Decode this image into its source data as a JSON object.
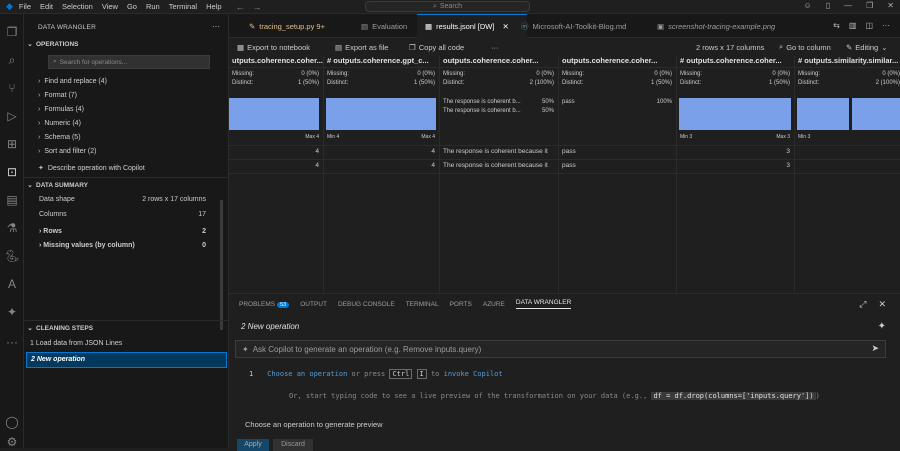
{
  "menu": [
    "File",
    "Edit",
    "Selection",
    "View",
    "Go",
    "Run",
    "Terminal",
    "Help"
  ],
  "search_label": "Search",
  "sidebar": {
    "title": "DATA WRANGLER",
    "operations_title": "OPERATIONS",
    "search_placeholder": "Search for operations...",
    "operations": [
      "Find and replace (4)",
      "Format (7)",
      "Formulas (4)",
      "Numeric (4)",
      "Schema (5)",
      "Sort and filter (2)"
    ],
    "describe_label": "Describe operation with Copilot",
    "summary_title": "DATA SUMMARY",
    "data_shape_label": "Data shape",
    "data_shape_value": "2 rows x 17 columns",
    "columns_label": "Columns",
    "columns_value": "17",
    "rows_label": "Rows",
    "rows_value": "2",
    "missing_label": "Missing values (by column)",
    "missing_value": "0",
    "cleaning_title": "CLEANING STEPS",
    "steps": [
      "1  Load data from JSON Lines",
      "2  New operation"
    ]
  },
  "tabs": [
    {
      "label": "tracing_setup.py 9+",
      "icon": "python-icon"
    },
    {
      "label": "Evaluation",
      "icon": "evaluation-icon"
    },
    {
      "label": "results.jsonl [DW]",
      "icon": "table-icon"
    },
    {
      "label": "Microsoft-AI-Toolkit-Blog.md",
      "icon": "markdown-icon"
    },
    {
      "label": "screenshot-tracing-example.png",
      "icon": "image-icon"
    }
  ],
  "toolbar": {
    "export_notebook": "Export to notebook",
    "export_file": "Export as file",
    "copy_code": "Copy all code",
    "more": "···",
    "shape": "2 rows x 17 columns",
    "goto": "Go to column",
    "editing": "Editing"
  },
  "columns": [
    {
      "header": "utputs.coherence.coher...",
      "missing": "0 (0%)",
      "distinct": "1 (50%)",
      "min": "",
      "max": "Max 4",
      "v1": "4",
      "v2": "4"
    },
    {
      "header": "# outputs.coherence.gpt_c...",
      "missing": "0 (0%)",
      "distinct": "1 (50%)",
      "min": "Min 4",
      "max": "Max 4",
      "v1": "4",
      "v2": "4"
    },
    {
      "header": "outputs.coherence.coher...",
      "missing": "0 (0%)",
      "distinct": "2 (100%)",
      "top1": "The response is coherent b...",
      "top1p": "50%",
      "top2": "The response is coherent b...",
      "top2p": "50%",
      "v1": "The response is coherent because it",
      "v2": "The response is coherent because it"
    },
    {
      "header": "outputs.coherence.coher...",
      "missing": "0 (0%)",
      "distinct": "1 (50%)",
      "top1": "pass",
      "top1p": "100%",
      "v1": "pass",
      "v2": "pass"
    },
    {
      "header": "# outputs.coherence.coher...",
      "missing": "0 (0%)",
      "distinct": "1 (50%)",
      "min": "Min 3",
      "max": "Max 3",
      "v1": "3",
      "v2": "3"
    },
    {
      "header": "# outputs.similarity.similar...",
      "missing": "0 (0%)",
      "distinct": "2 (100%)",
      "min": "Min 3",
      "max": "",
      "v1": "",
      "v2": ""
    }
  ],
  "stat_labels": {
    "missing": "Missing:",
    "distinct": "Distinct:"
  },
  "panel": {
    "tabs": [
      "PROBLEMS",
      "OUTPUT",
      "DEBUG CONSOLE",
      "TERMINAL",
      "PORTS",
      "AZURE",
      "DATA WRANGLER"
    ],
    "problems_badge": "53",
    "new_operation": "2  New operation",
    "copilot_placeholder": "Ask Copilot to generate an operation (e.g. Remove inputs.query)",
    "line_number": "1",
    "line1_a": "Choose an operation",
    "line1_b": " or press ",
    "key1": "Ctrl",
    "key2": "I",
    "line1_c": " to ",
    "line1_d": "invoke Copilot",
    "line2_a": "Or, start typing code to see a live preview of the transformation on your data (e.g.,",
    "line2_code": "df = df.drop(columns=['inputs.query'])",
    "line2_end": ")",
    "generate_hint": "Choose an operation to generate preview",
    "apply": "Apply",
    "discard": "Discard"
  }
}
